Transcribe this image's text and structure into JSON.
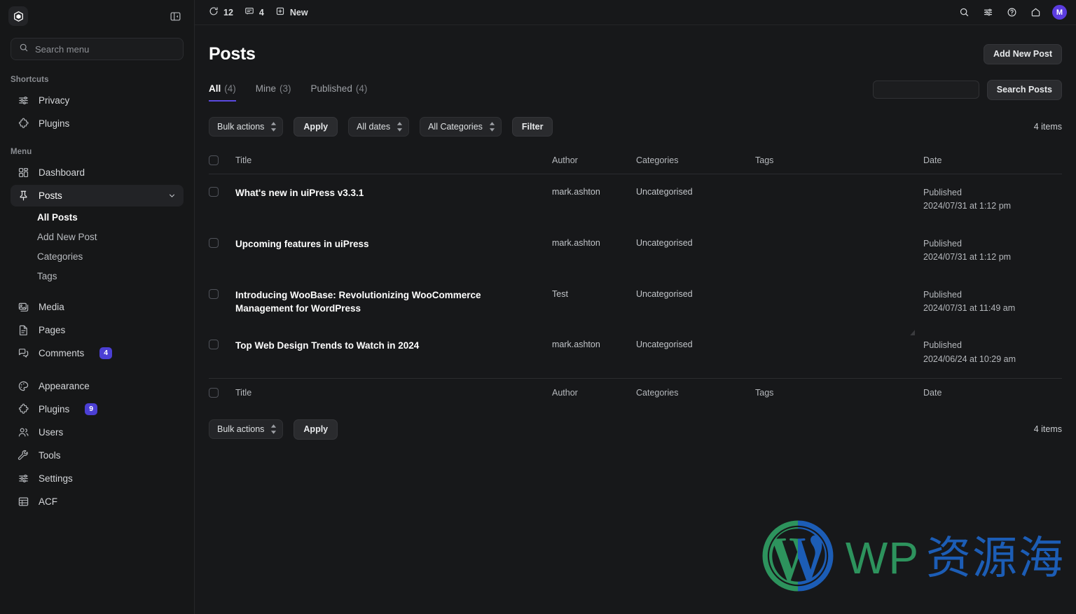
{
  "sidebar": {
    "logo_icon": "uipress-cube-logo",
    "panel_toggle_icon": "panel-collapse-icon",
    "search": {
      "placeholder": "Search menu",
      "value": "",
      "icon": "search-icon"
    },
    "shortcuts_label": "Shortcuts",
    "shortcuts": [
      {
        "label": "Privacy",
        "icon": "sliders-icon"
      },
      {
        "label": "Plugins",
        "icon": "puzzle-icon"
      }
    ],
    "menu_label": "Menu",
    "menu": [
      {
        "label": "Dashboard",
        "icon": "grid-icon"
      },
      {
        "label": "Posts",
        "icon": "pin-icon",
        "active": true,
        "expanded": true,
        "chevron": "chevron-down-icon"
      },
      {
        "label": "Media",
        "icon": "media-icon"
      },
      {
        "label": "Pages",
        "icon": "page-icon"
      },
      {
        "label": "Comments",
        "icon": "comments-icon",
        "badge": "4"
      },
      {
        "label": "Appearance",
        "icon": "palette-icon"
      },
      {
        "label": "Plugins",
        "icon": "puzzle-icon",
        "badge": "9"
      },
      {
        "label": "Users",
        "icon": "users-icon"
      },
      {
        "label": "Tools",
        "icon": "wrench-icon"
      },
      {
        "label": "Settings",
        "icon": "sliders-icon"
      },
      {
        "label": "ACF",
        "icon": "table-icon"
      }
    ],
    "submenu": [
      {
        "label": "All Posts",
        "current": true
      },
      {
        "label": "Add New Post",
        "current": false
      },
      {
        "label": "Categories",
        "current": false
      },
      {
        "label": "Tags",
        "current": false
      }
    ]
  },
  "topbar": {
    "updates": {
      "icon": "updates-icon",
      "count": "12"
    },
    "comments": {
      "icon": "comment-icon",
      "count": "4"
    },
    "new": {
      "icon": "add-box-icon",
      "label": "New"
    },
    "right_icons": [
      {
        "name": "search-icon"
      },
      {
        "name": "sliders-icon"
      },
      {
        "name": "help-icon"
      },
      {
        "name": "home-icon"
      }
    ],
    "avatar_initial": "M"
  },
  "page": {
    "title": "Posts",
    "add_new_label": "Add New Post"
  },
  "tabs": [
    {
      "label": "All",
      "count": "(4)",
      "active": true
    },
    {
      "label": "Mine",
      "count": "(3)",
      "active": false
    },
    {
      "label": "Published",
      "count": "(4)",
      "active": false
    }
  ],
  "search_posts": {
    "value": "",
    "placeholder": "",
    "button_label": "Search Posts"
  },
  "filters": {
    "bulk_actions_label": "Bulk actions",
    "apply_label": "Apply",
    "all_dates_label": "All dates",
    "all_categories_label": "All Categories",
    "filter_label": "Filter",
    "items_count": "4 items"
  },
  "table": {
    "columns": [
      "Title",
      "Author",
      "Categories",
      "Tags",
      "Date"
    ],
    "rows": [
      {
        "title": "What's new in uiPress v3.3.1",
        "author": "mark.ashton",
        "categories": "Uncategorised",
        "tags": "",
        "date_status": "Published",
        "date_value": "2024/07/31 at 1:12 pm"
      },
      {
        "title": "Upcoming features in uiPress",
        "author": "mark.ashton",
        "categories": "Uncategorised",
        "tags": "",
        "date_status": "Published",
        "date_value": "2024/07/31 at 1:12 pm"
      },
      {
        "title": "Introducing WooBase: Revolutionizing WooCommerce Management for WordPress",
        "author": "Test",
        "categories": "Uncategorised",
        "tags": "",
        "date_status": "Published",
        "date_value": "2024/07/31 at 11:49 am"
      },
      {
        "title": "Top Web Design Trends to Watch in 2024",
        "author": "mark.ashton",
        "categories": "Uncategorised",
        "tags": "",
        "date_status": "Published",
        "date_value": "2024/06/24 at 10:29 am"
      }
    ]
  },
  "footer": {
    "bulk_actions_label": "Bulk actions",
    "apply_label": "Apply",
    "items_count": "4 items"
  },
  "watermark": {
    "logo_icon": "wordpress-logo",
    "text_latin": "WP",
    "text_cjk": "资源海",
    "color_green": "#2f9e63",
    "color_blue": "#1d63c4"
  },
  "colors": {
    "accent": "#5b4ae0",
    "badge": "#4b3fd4",
    "background": "#17181a",
    "sidebar_background": "#161718"
  }
}
